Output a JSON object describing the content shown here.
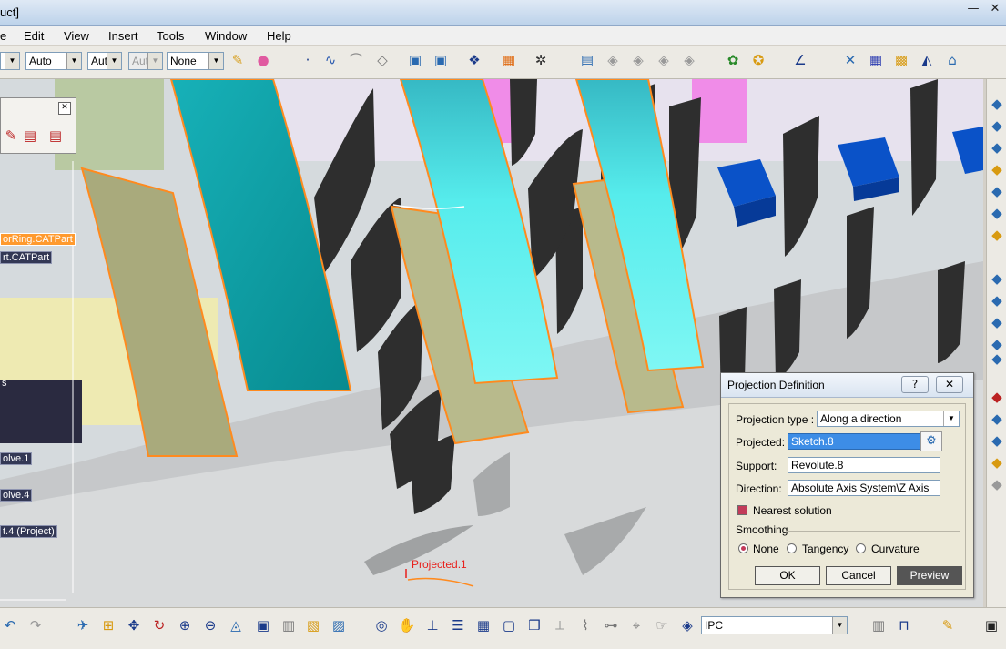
{
  "window": {
    "title_fragment": "uct]",
    "minimize_glyph": "—",
    "close_glyph": "✕"
  },
  "menu": {
    "items": [
      "e",
      "Edit",
      "View",
      "Insert",
      "Tools",
      "Window",
      "Help"
    ]
  },
  "toolbar": {
    "combos": [
      {
        "value": ""
      },
      {
        "value": "Auto"
      },
      {
        "value": "Aut"
      },
      {
        "value": "Aut",
        "disabled": true
      },
      {
        "value": "None"
      }
    ]
  },
  "tree": {
    "nodes": [
      {
        "label": "orRing.CATPart",
        "selected": true
      },
      {
        "label": "rt.CATPart"
      },
      {
        "label": "s"
      },
      {
        "label": "olve.1"
      },
      {
        "label": "olve.4"
      },
      {
        "label": "t.4 (Project)"
      }
    ]
  },
  "viewport": {
    "annotation": "Projected.1"
  },
  "dialog": {
    "title": "Projection Definition",
    "help_label": "?",
    "close_label": "✕",
    "projection_type_label": "Projection type :",
    "projection_type_value": "Along a direction",
    "projected_label": "Projected:",
    "projected_value": "Sketch.8",
    "support_label": "Support:",
    "support_value": "Revolute.8",
    "direction_label": "Direction:",
    "direction_value": "Absolute Axis System\\Z Axis",
    "nearest_solution_label": "Nearest solution",
    "smoothing_label": "Smoothing",
    "smoothing_options": [
      "None",
      "Tangency",
      "Curvature"
    ],
    "smoothing_selected": "None",
    "ok_label": "OK",
    "cancel_label": "Cancel",
    "preview_label": "Preview"
  },
  "bottom_toolbar": {
    "view_combo_value": "IPC"
  },
  "colors": {
    "teal_surface": "#0b9a9a",
    "cyan_surface": "#56ecec",
    "khaki_surface": "#a9aa7c",
    "selection_orange": "#ff8a1e",
    "blade_dark": "#2e2e2e",
    "block_blue": "#0a52c8",
    "annotation_red": "#e8201c"
  }
}
